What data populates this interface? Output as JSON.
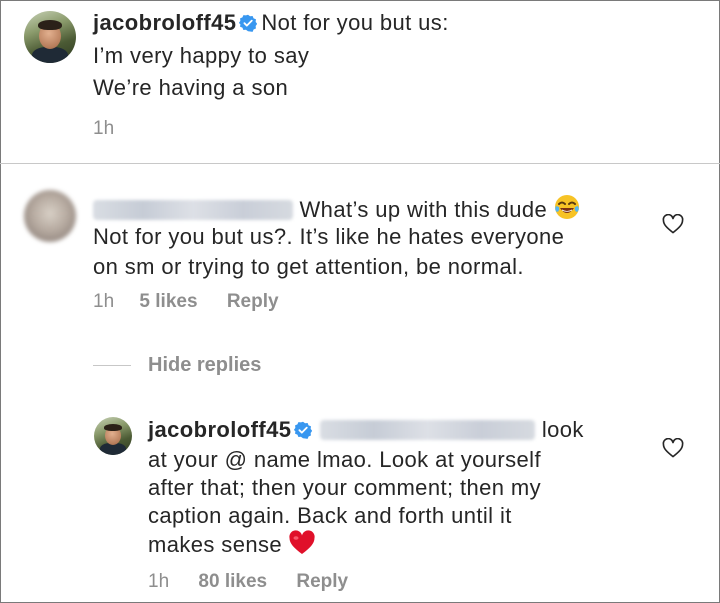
{
  "caption": {
    "username": "jacobroloff45",
    "lines": [
      "Not for you but us:",
      "I’m very happy to say",
      "We’re having a son"
    ],
    "time": "1h"
  },
  "comment": {
    "lines": [
      "What’s up with this dude",
      "Not for you but us?. It’s like he hates everyone",
      "on sm or trying to get attention, be normal."
    ],
    "time": "1h",
    "likes": "5 likes",
    "reply_label": "Reply",
    "emoji": "face-with-tears-of-joy"
  },
  "hide_replies_label": "Hide replies",
  "reply": {
    "username": "jacobroloff45",
    "lines": [
      "look",
      "at your @ name lmao. Look at yourself",
      "after that; then your comment; then my",
      "caption again. Back and forth until it",
      "makes sense"
    ],
    "time": "1h",
    "likes": "80 likes",
    "reply_label": "Reply",
    "emoji": "red-heart"
  },
  "colors": {
    "text": "#262626",
    "meta": "#8e8e8e",
    "verified": "#3897f0",
    "heart_emoji": "#e0102a"
  }
}
